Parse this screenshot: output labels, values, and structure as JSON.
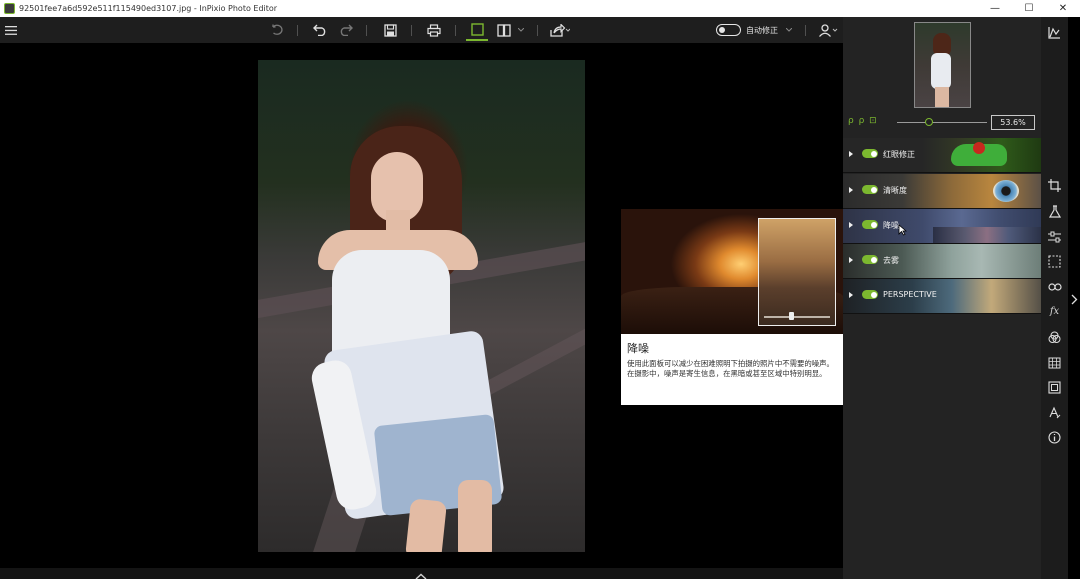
{
  "window": {
    "title": "92501fee7a6d592e511f115490ed3107.jpg - InPixio Photo Editor",
    "minimize": "—",
    "maximize": "☐",
    "close": "✕"
  },
  "toolbar": {
    "auto_fix_label": "自动修正"
  },
  "zoom": {
    "icons": "ρ ρ ⊡",
    "value": "53.6%"
  },
  "filters": [
    {
      "label": "红眼修正",
      "enabled": true
    },
    {
      "label": "清晰度",
      "enabled": true
    },
    {
      "label": "降噪",
      "enabled": true
    },
    {
      "label": "去雾",
      "enabled": true
    },
    {
      "label": "PERSPECTIVE",
      "enabled": true
    }
  ],
  "tooltip": {
    "title": "降噪",
    "description_line1": "使用此面板可以减少在困难照明下拍摄的照片中不需要的噪声。",
    "description_line2": "在摄影中，噪声是寄生信息，在黑暗或甚至区域中特别明显。"
  },
  "tools": {
    "fx_label": "fx"
  },
  "colors": {
    "accent": "#7cb82f",
    "panel": "#232323",
    "toolbar": "#1e1e1e"
  }
}
